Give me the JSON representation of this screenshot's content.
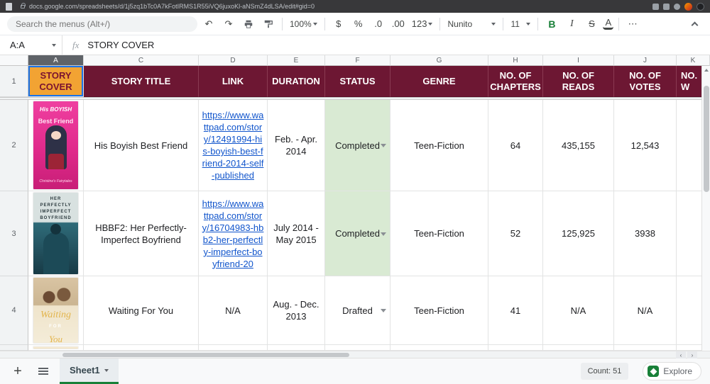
{
  "browser": {
    "url": "docs.google.com/spreadsheets/d/1j5zq1bTc0A7kFotIRMS1R55iVQ6juxoKl-aNSmZ4dLSA/edit#gid=0"
  },
  "toolbar": {
    "search_placeholder": "Search the menus (Alt+/)",
    "undo": "↶",
    "redo": "↷",
    "zoom": "100%",
    "currency": "$",
    "percent": "%",
    "decimal_decrease": ".0",
    "decimal_increase": ".00",
    "number_format": "123",
    "font_name": "Nunito",
    "font_size": "11",
    "bold": "B",
    "italic": "I",
    "strikethrough": "S",
    "text_color": "A",
    "more": "⋯"
  },
  "formula_bar": {
    "name_box": "A:A",
    "fx": "fx",
    "value": "STORY COVER"
  },
  "grid": {
    "column_letters": [
      "A",
      "C",
      "D",
      "E",
      "F",
      "G",
      "H",
      "I",
      "J",
      "K"
    ],
    "row_numbers": [
      "1",
      "2",
      "3",
      "4"
    ],
    "header": [
      "STORY COVER",
      "STORY TITLE",
      "LINK",
      "DURATION",
      "STATUS",
      "GENRE",
      "NO. OF CHAPTERS",
      "NO. OF READS",
      "NO. OF VOTES",
      "NO. W"
    ],
    "rows": [
      {
        "title": "His Boyish Best Friend",
        "link": "https://www.wattpad.com/story/12491994-his-boyish-best-friend-2014-self-published",
        "duration": "Feb. - Apr. 2014",
        "status": "Completed",
        "genre": "Teen-Fiction",
        "chapters": "64",
        "reads": "435,155",
        "votes": "12,543"
      },
      {
        "title": "HBBF2: Her Perfectly-Imperfect Boyfriend",
        "link": "https://www.wattpad.com/story/16704983-hbb2-her-perfectly-imperfect-boyfriend-20",
        "duration": "July 2014 - May 2015",
        "status": "Completed",
        "genre": "Teen-Fiction",
        "chapters": "52",
        "reads": "125,925",
        "votes": "3938"
      },
      {
        "title": "Waiting For You",
        "link": "N/A",
        "duration": "Aug. - Dec. 2013",
        "status": "Drafted",
        "genre": "Teen-Fiction",
        "chapters": "41",
        "reads": "N/A",
        "votes": "N/A"
      }
    ],
    "covers": [
      {
        "t1": "His BOYISH",
        "t2": "Best Friend",
        "footer": "Christine's Fairytales"
      },
      {
        "t1": "HER",
        "t2": "PERFECTLY",
        "t3": "IMPERFECT",
        "t4": "BOYFRIEND"
      },
      {
        "t1": "Waiting",
        "t2": "FOR",
        "t3": "You"
      }
    ]
  },
  "sheet_bar": {
    "sheet_name": "Sheet1",
    "count": "Count: 51",
    "explore": "Explore"
  },
  "colors": {
    "header_bg": "#6d1733",
    "header_cell_a_bg": "#f2a333",
    "status_completed_bg": "#d9ead3",
    "link": "#1155cc",
    "accent_green": "#188038"
  }
}
